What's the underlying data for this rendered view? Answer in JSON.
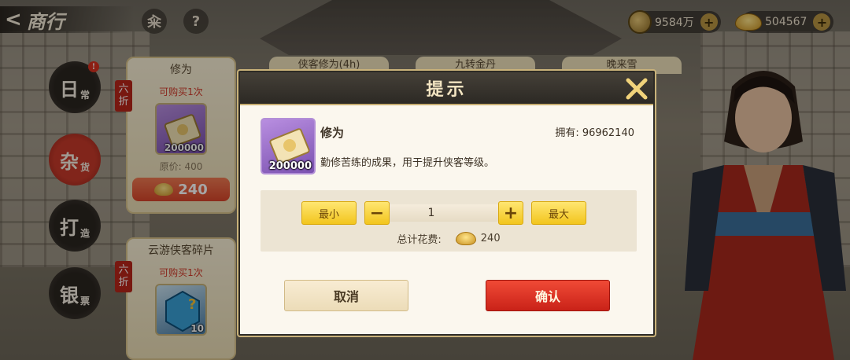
{
  "header": {
    "back_title": "商行",
    "menu_glyph": "籴",
    "help_glyph": "?",
    "silver": "9584万",
    "gold": "504567",
    "plus": "+"
  },
  "side_nav": [
    {
      "main": "日",
      "sub": "常",
      "badge": "!",
      "active": false
    },
    {
      "main": "杂",
      "sub": "货",
      "active": true
    },
    {
      "main": "打",
      "sub": "造",
      "active": false
    },
    {
      "main": "银",
      "sub": "票",
      "active": false
    }
  ],
  "shop_cards": [
    {
      "title": "修为",
      "discount": "六折",
      "limit": "可购买1次",
      "qty": "200000",
      "orig_price": "原价: 400",
      "price": "240"
    },
    {
      "title": "云游侠客碎片",
      "discount": "六折",
      "limit": "可购买1次",
      "qty": "10"
    }
  ],
  "shop_tabs": [
    "侠客修为(4h)",
    "九转金丹",
    "晚来雪"
  ],
  "dialog": {
    "title": "提示",
    "item_name": "修为",
    "item_qty": "200000",
    "owned": "拥有: 96962140",
    "description": "勤修苦练的成果，用于提升侠客等级。",
    "min_label": "最小",
    "max_label": "最大",
    "minus": "−",
    "plus": "+",
    "quantity": "1",
    "total_label": "总计花费:",
    "total_value": "240",
    "cancel_label": "取消",
    "confirm_label": "确认"
  },
  "colors": {
    "confirm": "#e0392a",
    "accent_gold": "#f2c51d",
    "dialog_header": "#2c2924"
  }
}
